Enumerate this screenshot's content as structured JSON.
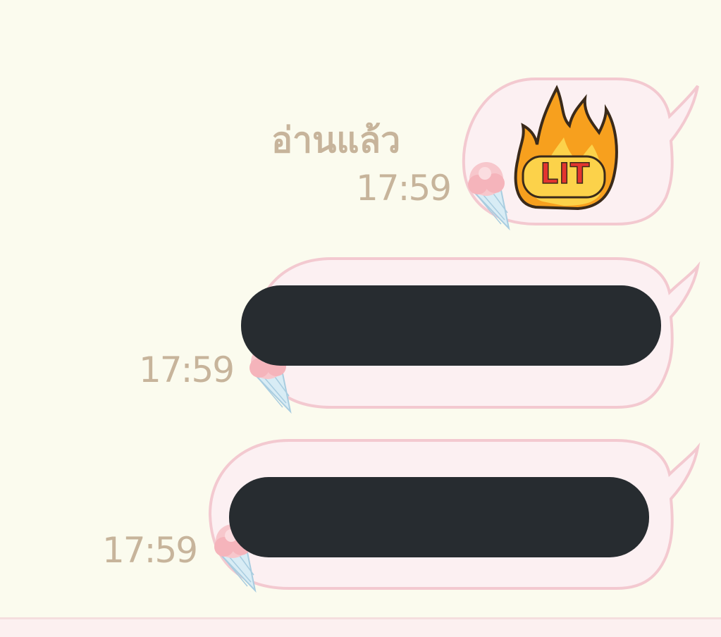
{
  "chat": {
    "messages": [
      {
        "kind": "sticker",
        "sticker_name": "lit-fire-sticker",
        "sticker_text": "LIT",
        "read_status": "อ่านแล้ว",
        "time": "17:59",
        "avatar_icon": "ice-cream-icon"
      },
      {
        "kind": "text",
        "redacted": true,
        "time": "17:59",
        "avatar_icon": "ice-cream-icon"
      },
      {
        "kind": "text",
        "redacted": true,
        "time": "17:59",
        "avatar_icon": "ice-cream-icon"
      }
    ]
  },
  "colors": {
    "background": "#fbfbee",
    "bubble_fill": "#fcf0f2",
    "bubble_border": "#f3c9d0",
    "meta_text": "#c7b49b",
    "redaction": "#272c30",
    "fire_orange": "#f7a01e",
    "lit_red": "#e3342f"
  }
}
